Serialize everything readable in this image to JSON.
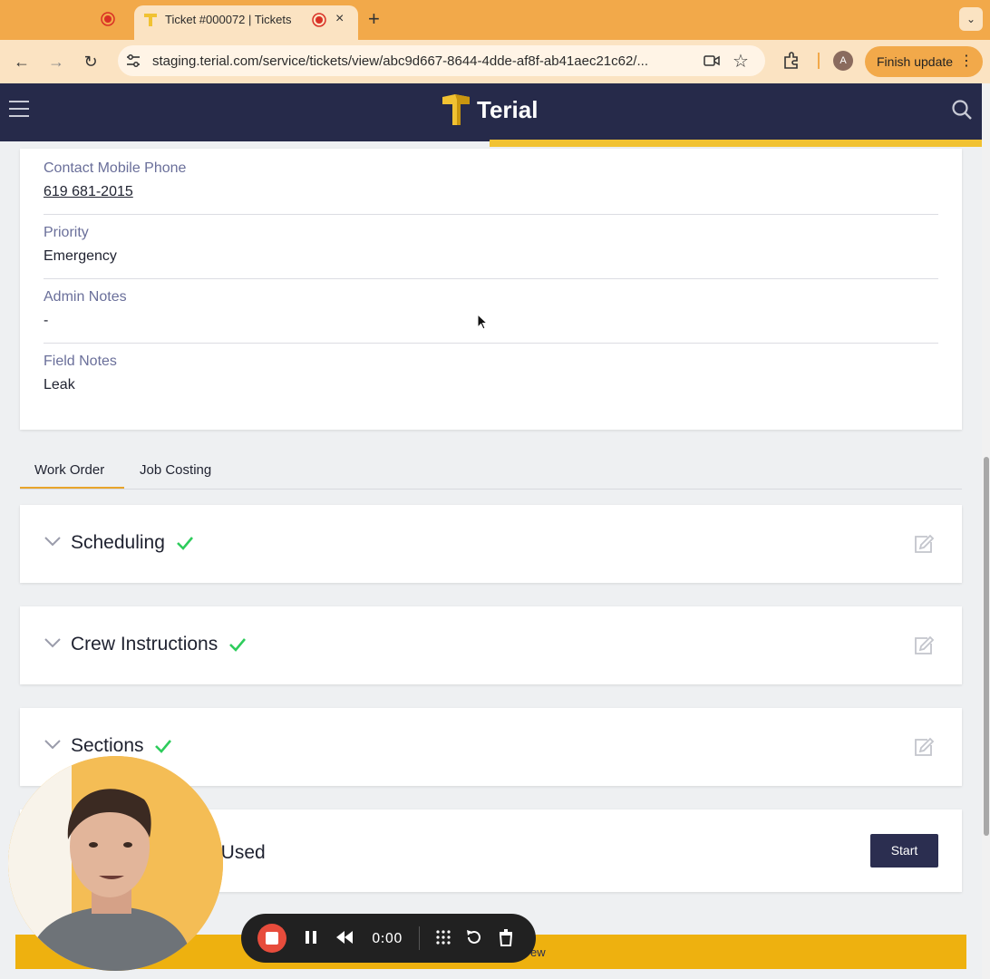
{
  "browser": {
    "active_tab_title": "Ticket #000072 | Tickets",
    "new_tab_glyph": "+",
    "close_glyph": "×",
    "tab_menu_glyph": "⌄",
    "url": "staging.terial.com/service/tickets/view/abc9d667-8644-4dde-af8f-ab41aec21c62/...",
    "profile_initial": "A",
    "finish_update_label": "Finish update",
    "nav": {
      "back": "←",
      "forward": "→",
      "reload": "↻"
    }
  },
  "app": {
    "logo_text": "Terial",
    "colors": {
      "header": "#262a4a",
      "accent": "#f1c232",
      "tab_underline": "#e8a52b",
      "check": "#2ecc5c"
    }
  },
  "details": {
    "fields": [
      {
        "label": "Contact Mobile Phone",
        "value": "619 681-2015"
      },
      {
        "label": "Priority",
        "value": "Emergency"
      },
      {
        "label": "Admin Notes",
        "value": "-"
      },
      {
        "label": "Field Notes",
        "value": "Leak"
      }
    ]
  },
  "tabs": [
    {
      "label": "Work Order",
      "active": true
    },
    {
      "label": "Job Costing",
      "active": false
    }
  ],
  "sections": [
    {
      "title": "Scheduling",
      "complete": true
    },
    {
      "title": "Crew Instructions",
      "complete": true
    },
    {
      "title": "Sections",
      "complete": true
    },
    {
      "title": "als Used",
      "start_label": "Start"
    }
  ],
  "bottom_bar": {
    "visible_text": "ew"
  },
  "recorder": {
    "time": "0:00"
  }
}
